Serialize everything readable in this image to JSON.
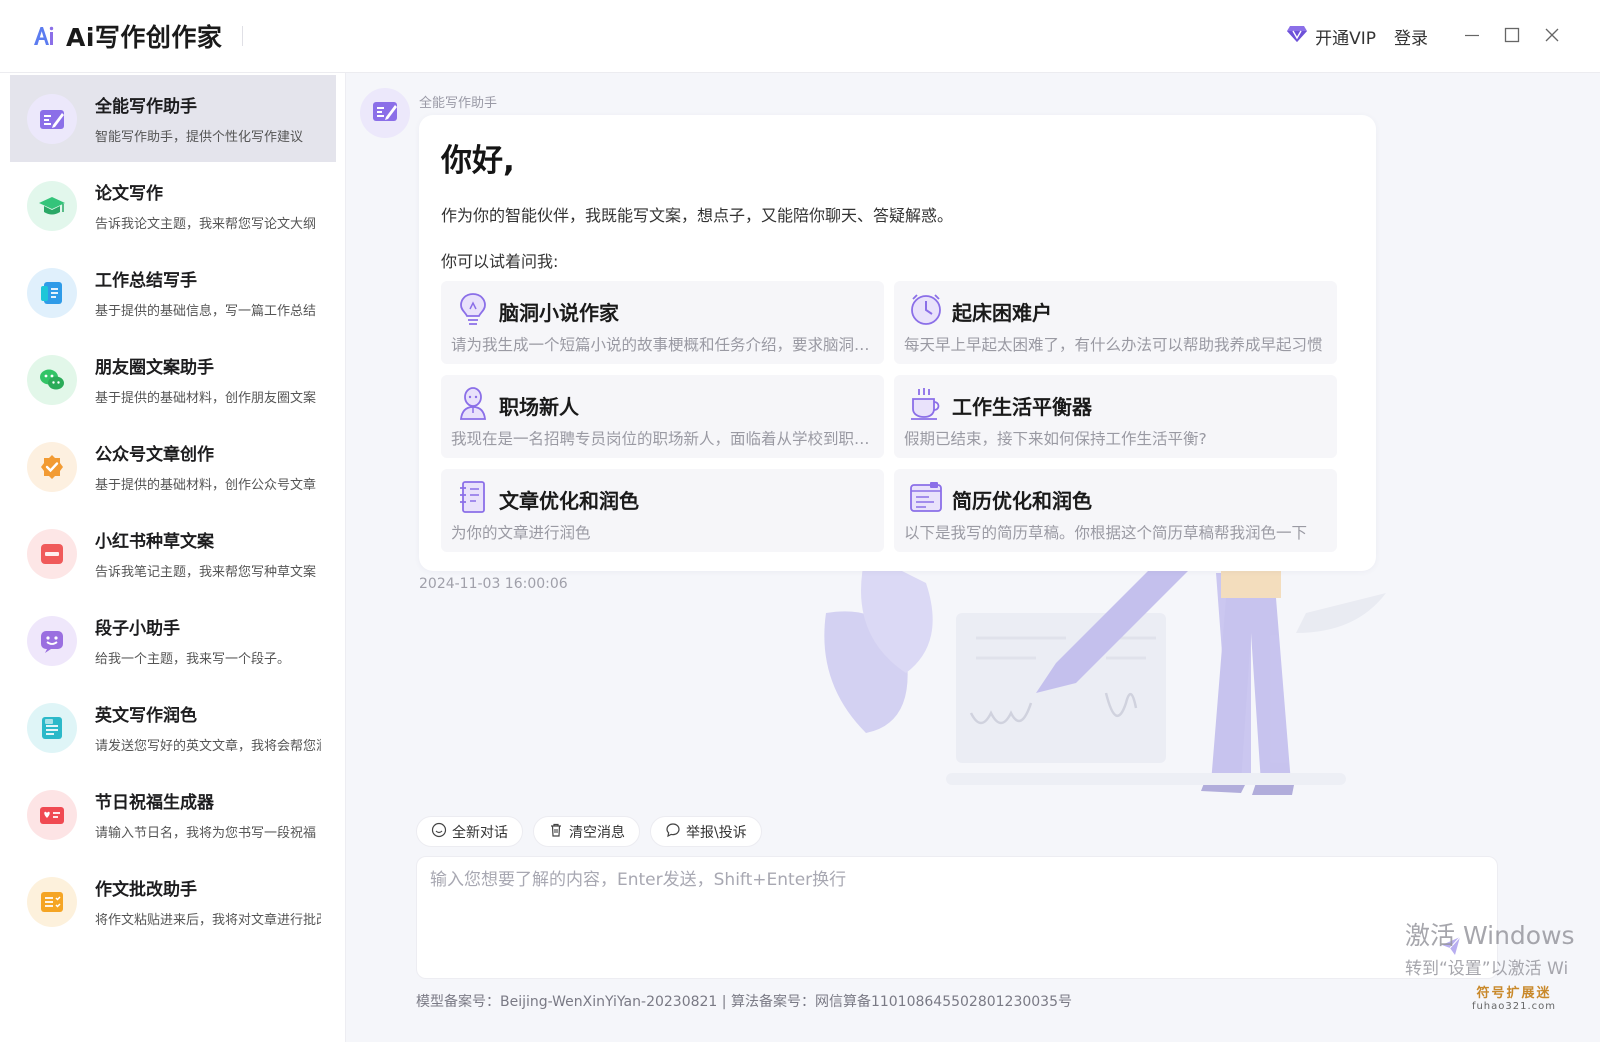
{
  "app": {
    "title": "Ai写作创作家",
    "vip_label": "开通VIP",
    "login_label": "登录"
  },
  "sidebar": {
    "items": [
      {
        "title": "全能写作助手",
        "desc": "智能写作助手，提供个性化写作建议",
        "icon": "pen-edit-icon",
        "color": "#8b6fe8"
      },
      {
        "title": "论文写作",
        "desc": "告诉我论文主题，我来帮您写论文大纲",
        "icon": "graduation-cap-icon",
        "color": "#34c47a"
      },
      {
        "title": "工作总结写手",
        "desc": "基于提供的基础信息，写一篇工作总结",
        "icon": "document-icon",
        "color": "#2f9be8"
      },
      {
        "title": "朋友圈文案助手",
        "desc": "基于提供的基础材料，创作朋友圈文案",
        "icon": "wechat-icon",
        "color": "#33c466"
      },
      {
        "title": "公众号文章创作",
        "desc": "基于提供的基础材料，创作公众号文章",
        "icon": "verified-badge-icon",
        "color": "#f29b33"
      },
      {
        "title": "小红书种草文案",
        "desc": "告诉我笔记主题，我来帮您写种草文案",
        "icon": "xiaohongshu-icon",
        "color": "#f05a5a"
      },
      {
        "title": "段子小助手",
        "desc": "给我一个主题，我来写一个段子。",
        "icon": "smiley-chat-icon",
        "color": "#9a6fe0"
      },
      {
        "title": "英文写作润色",
        "desc": "请发送您写好的英文文章，我将会帮您润色",
        "icon": "english-doc-icon",
        "color": "#2cb9c9"
      },
      {
        "title": "节日祝福生成器",
        "desc": "请输入节日名，我将为您书写一段祝福",
        "icon": "greeting-card-icon",
        "color": "#f04a52"
      },
      {
        "title": "作文批改助手",
        "desc": "将作文粘贴进来后，我将对文章进行批改",
        "icon": "checklist-icon",
        "color": "#f5a524"
      }
    ]
  },
  "chat": {
    "bot_name": "全能写作助手",
    "greeting": "你好,",
    "intro": "作为你的智能伙伴，我既能写文案，想点子，又能陪你聊天、答疑解惑。",
    "try_label": "你可以试着问我:",
    "suggestions": [
      {
        "title": "脑洞小说作家",
        "desc": "请为我生成一个短篇小说的故事梗概和任务介绍，要求脑洞大开",
        "icon": "lightbulb-icon"
      },
      {
        "title": "起床困难户",
        "desc": "每天早上早起太困难了，有什么办法可以帮助我养成早起习惯",
        "icon": "clock-icon"
      },
      {
        "title": "职场新人",
        "desc": "我现在是一名招聘专员岗位的职场新人，面临着从学校到职场的转变",
        "icon": "person-icon"
      },
      {
        "title": "工作生活平衡器",
        "desc": "假期已结束，接下来如何保持工作生活平衡?",
        "icon": "coffee-cup-icon"
      },
      {
        "title": "文章优化和润色",
        "desc": "为你的文章进行润色",
        "icon": "notebook-icon"
      },
      {
        "title": "简历优化和润色",
        "desc": "以下是我写的简历草稿。你根据这个简历草稿帮我润色一下",
        "icon": "resume-icon"
      }
    ],
    "timestamp": "2024-11-03 16:00:06"
  },
  "actions": {
    "new_chat": "全新对话",
    "clear": "清空消息",
    "report": "举报\\投诉"
  },
  "input": {
    "placeholder": "输入您想要了解的内容，Enter发送，Shift+Enter换行"
  },
  "footer": {
    "text": "模型备案号：Beijing-WenXinYiYan-20230821  |  算法备案号：网信算备110108645502801230035号"
  },
  "watermark": {
    "line1": "激活 Windows",
    "line2": "转到“设置”以激活 Wi"
  },
  "site_badge": {
    "line1": "符号扩展迷",
    "line2": "fuhao321.com"
  },
  "colors": {
    "accent": "#8b6fe8",
    "active_bg": "#e4e4ec",
    "page_bg": "#f5f6fa"
  }
}
